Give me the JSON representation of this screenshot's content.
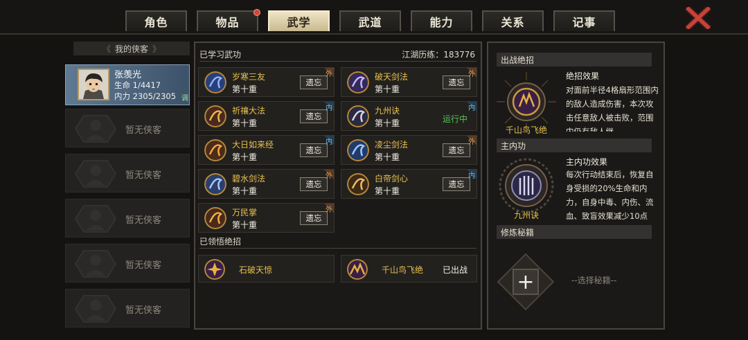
{
  "tabs": [
    {
      "label": "角色",
      "active": false,
      "badge": false
    },
    {
      "label": "物品",
      "active": false,
      "badge": true
    },
    {
      "label": "武学",
      "active": true,
      "badge": false
    },
    {
      "label": "武道",
      "active": false,
      "badge": false
    },
    {
      "label": "能力",
      "active": false,
      "badge": false
    },
    {
      "label": "关系",
      "active": false,
      "badge": false
    },
    {
      "label": "记事",
      "active": false,
      "badge": false
    }
  ],
  "left": {
    "header": "我的侠客",
    "hero": {
      "name": "张羡光",
      "life": "生命 1/4417",
      "inner": "内力 2305/2305",
      "adjust": "调"
    },
    "empty_label": "暂无侠客"
  },
  "center": {
    "learned_header": "已学习武功",
    "xp": "江湖历练：183776",
    "forget_label": "遗忘",
    "running_label": "运行中",
    "skills": [
      {
        "name": "岁寒三友",
        "level": "第十重",
        "tag": "外",
        "action": "遗忘"
      },
      {
        "name": "破天剑法",
        "level": "第十重",
        "tag": "外",
        "action": "遗忘"
      },
      {
        "name": "祈禳大法",
        "level": "第十重",
        "tag": "内",
        "action": "遗忘"
      },
      {
        "name": "九州诀",
        "level": "第十重",
        "tag": "内",
        "action": "运行中"
      },
      {
        "name": "大日如来经",
        "level": "第十重",
        "tag": "内",
        "action": "遗忘"
      },
      {
        "name": "凌尘剑法",
        "level": "第十重",
        "tag": "外",
        "action": "遗忘"
      },
      {
        "name": "碧水剑法",
        "level": "第十重",
        "tag": "外",
        "action": "遗忘"
      },
      {
        "name": "白帝剑心",
        "level": "第十重",
        "tag": "内",
        "action": "遗忘"
      },
      {
        "name": "万民掌",
        "level": "第十重",
        "tag": "外",
        "action": "遗忘"
      }
    ],
    "ultimate_header": "已领悟绝招",
    "ultimates": [
      {
        "name": "石破天惊",
        "status": ""
      },
      {
        "name": "千山鸟飞绝",
        "status": "已出战"
      }
    ]
  },
  "right": {
    "battle_header": "出战绝招",
    "battle_name": "千山鸟飞绝",
    "battle_effect_title": "绝招效果",
    "battle_effect_text": "对面前半径4格扇形范围内的敌人造成伤害，本次攻击任意敌人被击败，范围内仍有敌人继",
    "main_header": "主内功",
    "main_name": "九州诀",
    "main_effect_title": "主内功效果",
    "main_effect_text": "每次行动结束后，恢复自身受损的20%生命和内力，自身中毒、内伤、流血、致盲效果减少10点",
    "manual_header": "修炼秘籍",
    "plus": "+",
    "choose_label": "--选择秘籍--"
  },
  "colors": {
    "gold": "#e7c04e",
    "running": "#56c456",
    "tab_active": "#efe4c5",
    "close": "#c8423a"
  }
}
